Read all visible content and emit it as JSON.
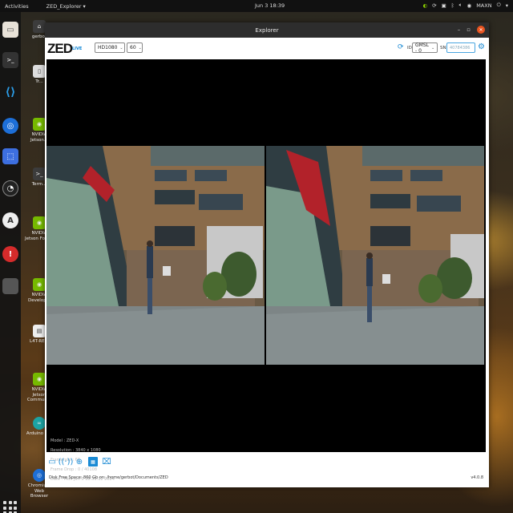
{
  "topbar": {
    "activities": "Activities",
    "app_menu": "ZED_Explorer",
    "clock": "Jun 3 18:39",
    "maxn": "MAXN"
  },
  "dock": {
    "items": [
      "files-icon",
      "terminal-icon",
      "vscode-icon",
      "chromium-icon",
      "screenshot-icon",
      "obs-icon",
      "arduino-icon",
      "error-icon",
      "blank-app-icon"
    ]
  },
  "desktop_icons": [
    {
      "label": "gerbot",
      "icon": "home-folder-icon"
    },
    {
      "label": "Tr...",
      "icon": "trash-icon"
    },
    {
      "label": "NVIDIA Jetson...",
      "icon": "nvidia-icon"
    },
    {
      "label": "Term...",
      "icon": "terminal-icon"
    },
    {
      "label": "NVIDIA Jetson Foru...",
      "icon": "nvidia-icon"
    },
    {
      "label": "NVIDIA Develop...",
      "icon": "nvidia-icon"
    },
    {
      "label": "L4T-RE...",
      "icon": "document-icon"
    },
    {
      "label": "NVIDIA Jetson Commun...",
      "icon": "nvidia-icon"
    },
    {
      "label": "Arduino IDE",
      "icon": "arduino-icon"
    },
    {
      "label": "Chromium Web Browser",
      "icon": "chromium-icon"
    }
  ],
  "window": {
    "title": "Explorer"
  },
  "toolbar": {
    "logo": "ZED",
    "live": "LIVE",
    "resolution": "HD1080",
    "fps": "60",
    "id_label": "ID",
    "camera": "GMSL - 0",
    "sn_label": "SN",
    "sn_placeholder": "40784386"
  },
  "camera_info": {
    "model": "Model : ZED-X",
    "resolution": "Resolution : 3840 x 1080",
    "framerate": "Framerate : 60",
    "frame_drop": "Frame Drop : 0 / 40108",
    "date": "Date : Mon Jun 3 18:39:12 2024"
  },
  "status": {
    "disk": "Disk Free Space: 860 Gb  on: /home/gerbot/Documents/ZED",
    "version": "v4.0.8"
  },
  "bottom_tools": [
    "folder-icon",
    "broadcast-icon",
    "globe-icon",
    "sensor-icon",
    "camera-icon"
  ],
  "colors": {
    "accent": "#1a8ad4",
    "close": "#e95420"
  }
}
